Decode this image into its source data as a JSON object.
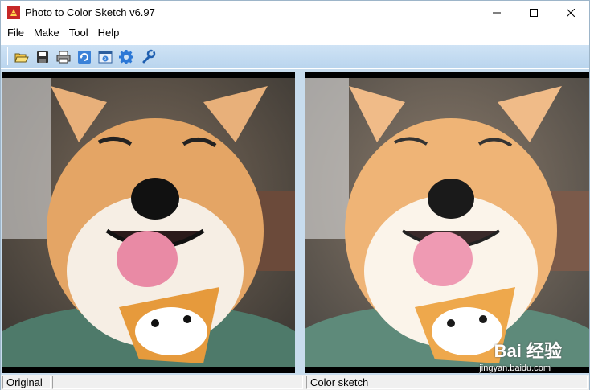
{
  "window": {
    "title": "Photo to Color Sketch v6.97"
  },
  "menu": [
    {
      "label": "File"
    },
    {
      "label": "Make"
    },
    {
      "label": "Tool"
    },
    {
      "label": "Help"
    }
  ],
  "toolbar": {
    "buttons": [
      {
        "icon": "open-folder-icon"
      },
      {
        "icon": "save-disk-icon"
      },
      {
        "icon": "print-icon"
      },
      {
        "icon": "refresh-icon"
      },
      {
        "icon": "browser-icon"
      },
      {
        "icon": "settings-gear-icon"
      },
      {
        "icon": "wrench-icon"
      }
    ]
  },
  "panes": {
    "left_label": "Original",
    "right_label": "Color sketch"
  },
  "watermark": {
    "main": "Bai 经验",
    "sub": "jingyan.baidu.com"
  },
  "colors": {
    "toolbar_bg": "#c6dcf0",
    "pane_bg": "#c8dced",
    "accent_blue": "#2c78d6"
  }
}
